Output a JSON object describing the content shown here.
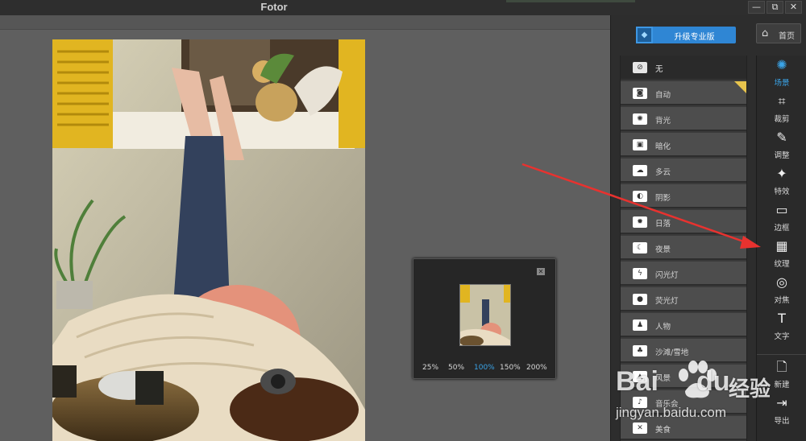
{
  "app": {
    "title": "Fotor",
    "window_buttons": {
      "minimize": "—",
      "restore": "⧉",
      "close": "✕"
    }
  },
  "header": {
    "upgrade_label": "升级专业版",
    "upgrade_icon": "diamond-icon",
    "home_label": "首页",
    "home_icon": "home-icon"
  },
  "zoom": {
    "levels": [
      "25%",
      "50%",
      "100%",
      "150%",
      "200%"
    ],
    "selected": "100%",
    "close": "✕"
  },
  "scenes": {
    "items": [
      {
        "label": "无",
        "icon": "none-icon",
        "selected": true
      },
      {
        "label": "自动",
        "icon": "camera-icon",
        "pro": true
      },
      {
        "label": "背光",
        "icon": "backlight-icon"
      },
      {
        "label": "暗化",
        "icon": "darken-icon"
      },
      {
        "label": "多云",
        "icon": "cloud-icon"
      },
      {
        "label": "阴影",
        "icon": "shadow-icon"
      },
      {
        "label": "日落",
        "icon": "sunset-icon"
      },
      {
        "label": "夜景",
        "icon": "moon-icon"
      },
      {
        "label": "闪光灯",
        "icon": "flash-icon"
      },
      {
        "label": "荧光灯",
        "icon": "bulb-icon"
      },
      {
        "label": "人物",
        "icon": "person-icon"
      },
      {
        "label": "沙滩/雪地",
        "icon": "beach-icon"
      },
      {
        "label": "风景",
        "icon": "landscape-icon"
      },
      {
        "label": "音乐会",
        "icon": "music-icon"
      },
      {
        "label": "美食",
        "icon": "food-icon"
      }
    ]
  },
  "tools": {
    "items": [
      {
        "label": "场景",
        "icon": "sun-icon",
        "glyph": "✺",
        "active": true
      },
      {
        "label": "裁剪",
        "icon": "crop-icon",
        "glyph": "⌗"
      },
      {
        "label": "调整",
        "icon": "pencil-icon",
        "glyph": "✎"
      },
      {
        "label": "特效",
        "icon": "sparkle-icon",
        "glyph": "✦"
      },
      {
        "label": "边框",
        "icon": "frame-icon",
        "glyph": "▭"
      },
      {
        "label": "纹理",
        "icon": "texture-icon",
        "glyph": "▦"
      },
      {
        "label": "对焦",
        "icon": "focus-icon",
        "glyph": "◎"
      },
      {
        "label": "文字",
        "icon": "text-icon",
        "glyph": "T"
      },
      {
        "label": "新建",
        "icon": "new-file-icon",
        "glyph": "🗋"
      },
      {
        "label": "导出",
        "icon": "export-icon",
        "glyph": "⇥"
      }
    ]
  },
  "annotation": {
    "color": "#e8322f"
  },
  "watermark": {
    "logo": "Bai",
    "logo2": "du",
    "brand": "经验",
    "url": "jingyan.baidu.com"
  },
  "colors": {
    "accent": "#3aa4e8",
    "upgrade": "#2f86d4",
    "pro_badge": "#e7c44d"
  }
}
